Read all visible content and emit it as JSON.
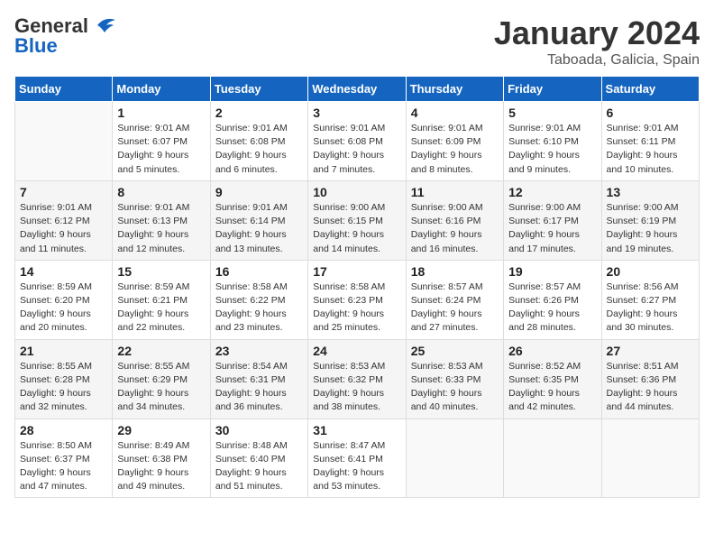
{
  "header": {
    "logo_general": "General",
    "logo_blue": "Blue",
    "month": "January 2024",
    "location": "Taboada, Galicia, Spain"
  },
  "days_of_week": [
    "Sunday",
    "Monday",
    "Tuesday",
    "Wednesday",
    "Thursday",
    "Friday",
    "Saturday"
  ],
  "weeks": [
    [
      {
        "day": "",
        "info": ""
      },
      {
        "day": "1",
        "info": "Sunrise: 9:01 AM\nSunset: 6:07 PM\nDaylight: 9 hours\nand 5 minutes."
      },
      {
        "day": "2",
        "info": "Sunrise: 9:01 AM\nSunset: 6:08 PM\nDaylight: 9 hours\nand 6 minutes."
      },
      {
        "day": "3",
        "info": "Sunrise: 9:01 AM\nSunset: 6:08 PM\nDaylight: 9 hours\nand 7 minutes."
      },
      {
        "day": "4",
        "info": "Sunrise: 9:01 AM\nSunset: 6:09 PM\nDaylight: 9 hours\nand 8 minutes."
      },
      {
        "day": "5",
        "info": "Sunrise: 9:01 AM\nSunset: 6:10 PM\nDaylight: 9 hours\nand 9 minutes."
      },
      {
        "day": "6",
        "info": "Sunrise: 9:01 AM\nSunset: 6:11 PM\nDaylight: 9 hours\nand 10 minutes."
      }
    ],
    [
      {
        "day": "7",
        "info": "Sunrise: 9:01 AM\nSunset: 6:12 PM\nDaylight: 9 hours\nand 11 minutes."
      },
      {
        "day": "8",
        "info": "Sunrise: 9:01 AM\nSunset: 6:13 PM\nDaylight: 9 hours\nand 12 minutes."
      },
      {
        "day": "9",
        "info": "Sunrise: 9:01 AM\nSunset: 6:14 PM\nDaylight: 9 hours\nand 13 minutes."
      },
      {
        "day": "10",
        "info": "Sunrise: 9:00 AM\nSunset: 6:15 PM\nDaylight: 9 hours\nand 14 minutes."
      },
      {
        "day": "11",
        "info": "Sunrise: 9:00 AM\nSunset: 6:16 PM\nDaylight: 9 hours\nand 16 minutes."
      },
      {
        "day": "12",
        "info": "Sunrise: 9:00 AM\nSunset: 6:17 PM\nDaylight: 9 hours\nand 17 minutes."
      },
      {
        "day": "13",
        "info": "Sunrise: 9:00 AM\nSunset: 6:19 PM\nDaylight: 9 hours\nand 19 minutes."
      }
    ],
    [
      {
        "day": "14",
        "info": "Sunrise: 8:59 AM\nSunset: 6:20 PM\nDaylight: 9 hours\nand 20 minutes."
      },
      {
        "day": "15",
        "info": "Sunrise: 8:59 AM\nSunset: 6:21 PM\nDaylight: 9 hours\nand 22 minutes."
      },
      {
        "day": "16",
        "info": "Sunrise: 8:58 AM\nSunset: 6:22 PM\nDaylight: 9 hours\nand 23 minutes."
      },
      {
        "day": "17",
        "info": "Sunrise: 8:58 AM\nSunset: 6:23 PM\nDaylight: 9 hours\nand 25 minutes."
      },
      {
        "day": "18",
        "info": "Sunrise: 8:57 AM\nSunset: 6:24 PM\nDaylight: 9 hours\nand 27 minutes."
      },
      {
        "day": "19",
        "info": "Sunrise: 8:57 AM\nSunset: 6:26 PM\nDaylight: 9 hours\nand 28 minutes."
      },
      {
        "day": "20",
        "info": "Sunrise: 8:56 AM\nSunset: 6:27 PM\nDaylight: 9 hours\nand 30 minutes."
      }
    ],
    [
      {
        "day": "21",
        "info": "Sunrise: 8:55 AM\nSunset: 6:28 PM\nDaylight: 9 hours\nand 32 minutes."
      },
      {
        "day": "22",
        "info": "Sunrise: 8:55 AM\nSunset: 6:29 PM\nDaylight: 9 hours\nand 34 minutes."
      },
      {
        "day": "23",
        "info": "Sunrise: 8:54 AM\nSunset: 6:31 PM\nDaylight: 9 hours\nand 36 minutes."
      },
      {
        "day": "24",
        "info": "Sunrise: 8:53 AM\nSunset: 6:32 PM\nDaylight: 9 hours\nand 38 minutes."
      },
      {
        "day": "25",
        "info": "Sunrise: 8:53 AM\nSunset: 6:33 PM\nDaylight: 9 hours\nand 40 minutes."
      },
      {
        "day": "26",
        "info": "Sunrise: 8:52 AM\nSunset: 6:35 PM\nDaylight: 9 hours\nand 42 minutes."
      },
      {
        "day": "27",
        "info": "Sunrise: 8:51 AM\nSunset: 6:36 PM\nDaylight: 9 hours\nand 44 minutes."
      }
    ],
    [
      {
        "day": "28",
        "info": "Sunrise: 8:50 AM\nSunset: 6:37 PM\nDaylight: 9 hours\nand 47 minutes."
      },
      {
        "day": "29",
        "info": "Sunrise: 8:49 AM\nSunset: 6:38 PM\nDaylight: 9 hours\nand 49 minutes."
      },
      {
        "day": "30",
        "info": "Sunrise: 8:48 AM\nSunset: 6:40 PM\nDaylight: 9 hours\nand 51 minutes."
      },
      {
        "day": "31",
        "info": "Sunrise: 8:47 AM\nSunset: 6:41 PM\nDaylight: 9 hours\nand 53 minutes."
      },
      {
        "day": "",
        "info": ""
      },
      {
        "day": "",
        "info": ""
      },
      {
        "day": "",
        "info": ""
      }
    ]
  ]
}
